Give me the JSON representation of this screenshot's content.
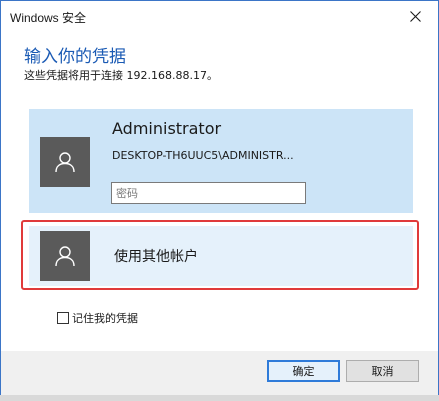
{
  "window": {
    "title": "Windows 安全"
  },
  "header": {
    "title": "输入你的凭据",
    "subtitle": "这些凭据将用于连接 192.168.88.17。"
  },
  "account": {
    "name": "Administrator",
    "domain_user": "DESKTOP-TH6UUC5\\ADMINISTR...",
    "password_placeholder": "密码",
    "password_value": ""
  },
  "other_account": {
    "label": "使用其他帐户"
  },
  "remember": {
    "label": "记住我的凭据",
    "checked": false
  },
  "buttons": {
    "ok": "确定",
    "cancel": "取消"
  },
  "colors": {
    "accent": "#1a5ab4",
    "selected_card": "#cce4f7",
    "hover_card": "#e5f1fb",
    "highlight_border": "#e03a3a",
    "avatar": "#5a5a5a"
  }
}
